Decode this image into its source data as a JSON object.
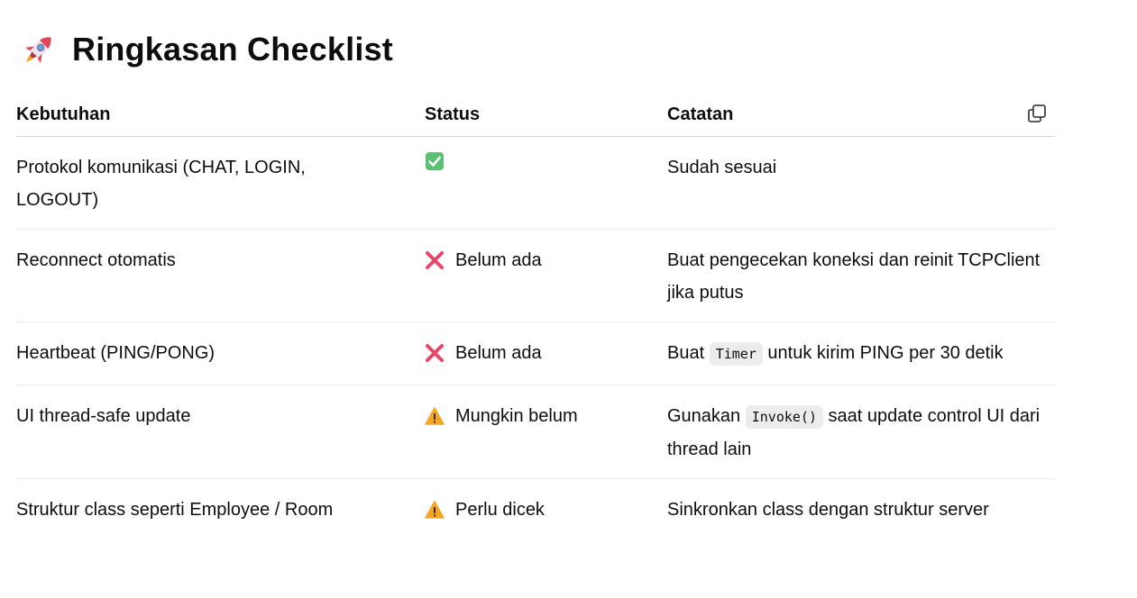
{
  "heading": {
    "icon": "rocket-icon",
    "title": "Ringkasan Checklist"
  },
  "table": {
    "headers": [
      "Kebutuhan",
      "Status",
      "Catatan"
    ],
    "copy_icon": "copy-icon",
    "rows": [
      {
        "requirement": "Protokol komunikasi (CHAT, LOGIN, LOGOUT)",
        "status_icon": "check-icon",
        "status_text": "",
        "note_pre": "Sudah sesuai",
        "note_code": "",
        "note_post": ""
      },
      {
        "requirement": "Reconnect otomatis",
        "status_icon": "cross-icon",
        "status_text": "Belum ada",
        "note_pre": "Buat pengecekan koneksi dan reinit TCPClient jika putus",
        "note_code": "",
        "note_post": ""
      },
      {
        "requirement": "Heartbeat (PING/PONG)",
        "status_icon": "cross-icon",
        "status_text": "Belum ada",
        "note_pre": "Buat ",
        "note_code": "Timer",
        "note_post": " untuk kirim PING per 30 detik"
      },
      {
        "requirement": "UI thread-safe update",
        "status_icon": "warning-icon",
        "status_text": "Mungkin belum",
        "note_pre": "Gunakan ",
        "note_code": "Invoke()",
        "note_post": " saat update control UI dari thread lain"
      },
      {
        "requirement": "Struktur class seperti Employee / Room",
        "status_icon": "warning-icon",
        "status_text": "Perlu dicek",
        "note_pre": "Sinkronkan class dengan struktur server",
        "note_code": "",
        "note_post": ""
      }
    ]
  }
}
